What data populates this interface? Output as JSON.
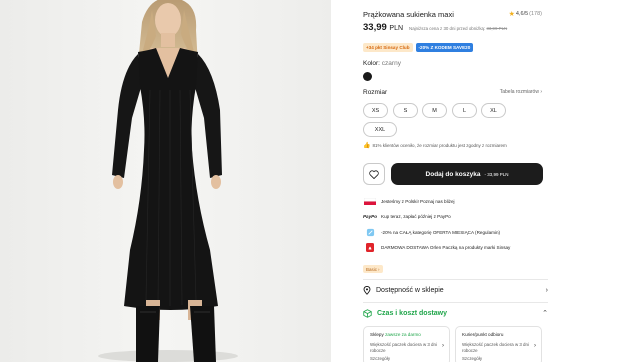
{
  "product": {
    "title": "Prążkowana sukienka maxi",
    "rating": "4,6/5",
    "rating_count": "(178)",
    "price": "33,99",
    "currency": "PLN",
    "lowest_price_note": "Najniższa cena z 30 dni przed obniżką:",
    "lowest_price_old": "33,99 PLN"
  },
  "badges": {
    "club": "+34 pkt Sinsay Club",
    "code": "-20% Z KODEM SAVE20"
  },
  "color": {
    "label": "Kolor:",
    "value": "czarny",
    "swatch_hex": "#1a1a1a"
  },
  "size": {
    "label": "Rozmiar",
    "table_link": "Tabela rozmiarów",
    "options": [
      "XS",
      "S",
      "M",
      "L",
      "XL",
      "XXL"
    ]
  },
  "fit_note": "81% klientów oceniło, że rozmiar produktu jest zgodny z rozmiarem",
  "cart": {
    "label": "Dodaj do koszyka",
    "price": "33,99 PLN"
  },
  "perks": [
    {
      "icon": "polish-flag-icon",
      "text": "Jesteśmy z Polski! Poznaj nas bliżej"
    },
    {
      "icon": "paypo-logo-icon",
      "logo_text": "PayPo",
      "text": "Kup teraz, zapłać później z PayPo"
    },
    {
      "icon": "discount-tag-icon",
      "text": "-20% na CAŁĄ kategorię OFERTA MIESIĄCA (Regulamin)"
    },
    {
      "icon": "orlen-logo-icon",
      "text": "DARMOWA DOSTAWA Orlen Paczką na produkty marki Sinsay"
    }
  ],
  "basic_tag": "Basic",
  "availability": "Dostępność w sklepie",
  "delivery": "Czas i koszt dostawy",
  "delivery_cards": [
    {
      "title": "Sklepy",
      "title_green": "zawsze za darmo",
      "desc": "Większość paczek dociera w 3 dni robocze",
      "desc2": "Szczegóły"
    },
    {
      "title": "Kurier/punkt odbioru",
      "title_green": "",
      "desc": "Większość paczek dociera w 3 dni robocze",
      "desc2": "Szczegóły"
    }
  ],
  "colors": {
    "accent_green": "#1fa54a",
    "club_orange": "#d5680f",
    "code_blue": "#2f7fe0",
    "button_dark": "#1c1c1c"
  }
}
